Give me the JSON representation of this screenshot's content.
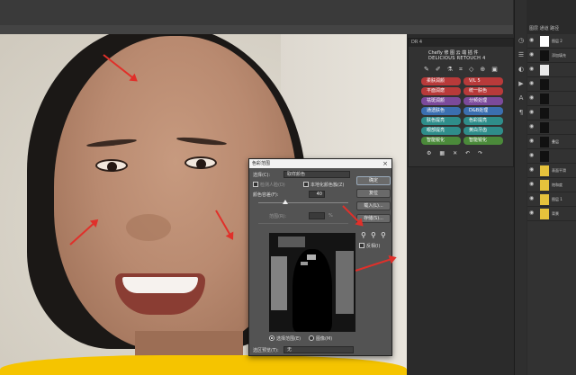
{
  "dr_panel": {
    "header": "DR 4",
    "brand_line1": "Chefly 修 图 云 端 插 件",
    "brand_line2": "DELICIOUS RETOUCH 4",
    "buttons": [
      {
        "label": "柔肤润颜",
        "color": "#b83a3a"
      },
      {
        "label": "V/L 5",
        "color": "#b83a3a"
      },
      {
        "label": "平面润磨",
        "color": "#b83a3a"
      },
      {
        "label": "统一肤色",
        "color": "#b83a3a"
      },
      {
        "label": "祛斑润颜",
        "color": "#7c4a9b"
      },
      {
        "label": "分频处理",
        "color": "#7c4a9b"
      },
      {
        "label": "通透肤色",
        "color": "#3b6fb0"
      },
      {
        "label": "D&B处理",
        "color": "#3b6fb0"
      },
      {
        "label": "肤色提亮",
        "color": "#2f8d8a"
      },
      {
        "label": "色彩提亮",
        "color": "#2f8d8a"
      },
      {
        "label": "眼部提亮",
        "color": "#2f8d8a"
      },
      {
        "label": "黄白牙齿",
        "color": "#2f8d8a"
      },
      {
        "label": "智能锐化",
        "color": "#4b8a3a"
      },
      {
        "label": "智能锐化",
        "color": "#4b8a3a"
      }
    ],
    "footer_icons": [
      "gear-icon",
      "grid-icon",
      "close-x-icon",
      "undo-icon",
      "redo-icon"
    ]
  },
  "layers_panel": {
    "tabs": "图层  通道  路径",
    "rows": [
      {
        "name": "图层 2",
        "thumb": "#ffffff"
      },
      {
        "name": "添加填充",
        "thumb": "#111111"
      },
      {
        "name": "",
        "thumb": "#e8e8e8"
      },
      {
        "name": "",
        "thumb": "#111111"
      },
      {
        "name": "",
        "thumb": "#111111"
      },
      {
        "name": "",
        "thumb": "#111111"
      },
      {
        "name": "",
        "thumb": "#111111"
      },
      {
        "name": "叠层",
        "thumb": "#111111"
      },
      {
        "name": "",
        "thumb": "#111111"
      },
      {
        "name": "表面平滑",
        "thumb": "#e6c23c"
      },
      {
        "name": "饱和度",
        "thumb": "#e6c23c"
      },
      {
        "name": "图层 1",
        "thumb": "#e6c23c"
      },
      {
        "name": "背景",
        "thumb": "#e6c23c"
      }
    ]
  },
  "dialog": {
    "title": "色彩范围",
    "select_label": "选择(C):",
    "select_value": "取样颜色",
    "detect_faces": "检测人脸(D)",
    "localized": "本地化颜色簇(Z)",
    "fuzziness_label": "颜色容差(F):",
    "fuzziness_value": "40",
    "range_label": "范围(R):",
    "range_unit": "%",
    "ok": "确定",
    "cancel": "复位",
    "load": "载入(L)...",
    "save": "存储(S)...",
    "invert": "反相(I)",
    "selection_label": "选择范围(E)",
    "image_label": "图像(M)",
    "preview_label": "选区预览(T):",
    "preview_value": "无"
  }
}
